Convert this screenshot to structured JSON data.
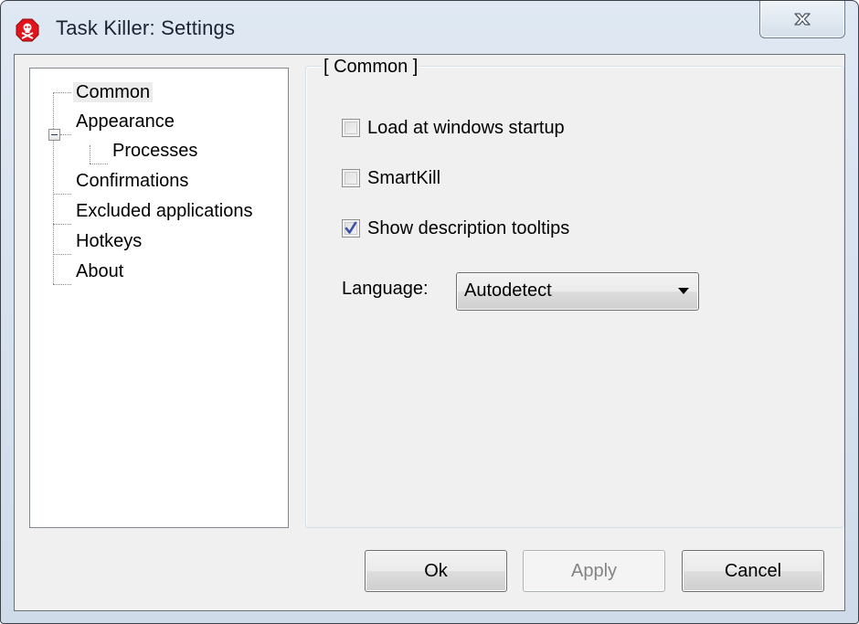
{
  "window": {
    "title": "Task Killer: Settings",
    "app_icon": "skull-stop-icon",
    "close_icon": "close-icon"
  },
  "tree": {
    "items": [
      {
        "label": "Common",
        "level": 0,
        "selected": true
      },
      {
        "label": "Appearance",
        "level": 0,
        "expanded": true
      },
      {
        "label": "Processes",
        "level": 1
      },
      {
        "label": "Confirmations",
        "level": 0
      },
      {
        "label": "Excluded applications",
        "level": 0
      },
      {
        "label": "Hotkeys",
        "level": 0
      },
      {
        "label": "About",
        "level": 0
      }
    ]
  },
  "panel": {
    "legend": "[ Common ]",
    "options": [
      {
        "label": "Load at windows startup",
        "checked": false
      },
      {
        "label": "SmartKill",
        "checked": false
      },
      {
        "label": "Show description tooltips",
        "checked": true
      }
    ],
    "language": {
      "label": "Language:",
      "value": "Autodetect"
    }
  },
  "buttons": {
    "ok": "Ok",
    "apply": "Apply",
    "apply_enabled": false,
    "cancel": "Cancel"
  },
  "colors": {
    "icon_red": "#e0161c",
    "check_blue": "#3a4fa8"
  }
}
